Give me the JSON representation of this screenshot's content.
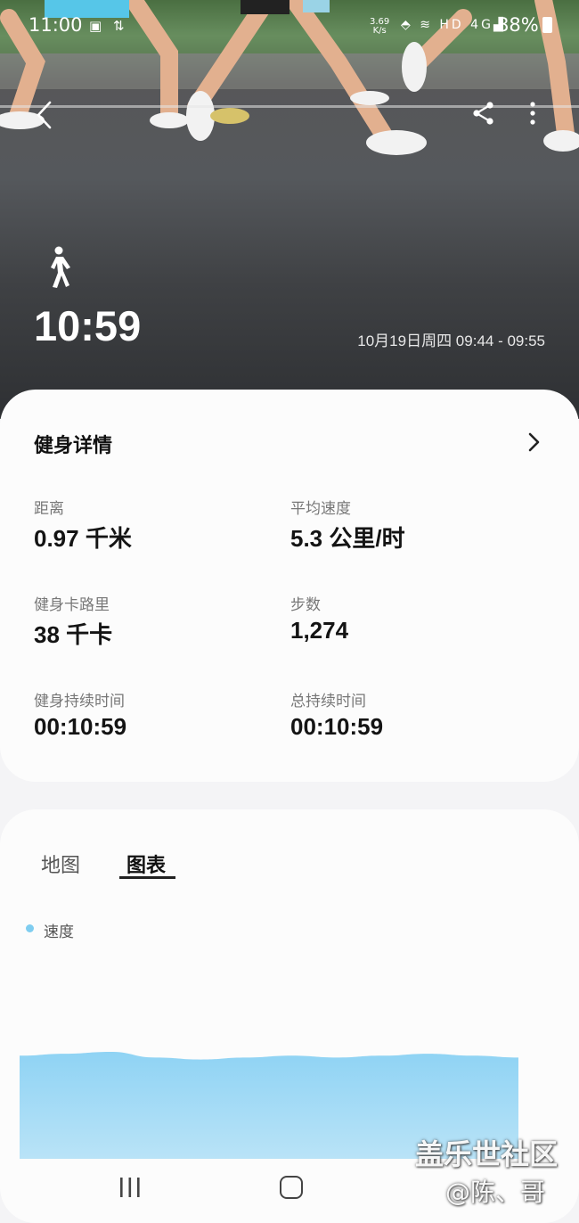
{
  "status_bar": {
    "time": "11:00",
    "net_speed_value": "3.69",
    "net_speed_unit": "K/s",
    "hd_label": "HD",
    "signal_label": "4G",
    "battery": "88%"
  },
  "workout": {
    "duration": "10:59",
    "date_range": "10月19日周四 09:44 - 09:55"
  },
  "details": {
    "title": "健身详情",
    "metrics": [
      {
        "label": "距离",
        "value": "0.97 千米"
      },
      {
        "label": "平均速度",
        "value": "5.3 公里/时"
      },
      {
        "label": "健身卡路里",
        "value": "38 千卡"
      },
      {
        "label": "步数",
        "value": "1,274"
      },
      {
        "label": "健身持续时间",
        "value": "00:10:59"
      },
      {
        "label": "总持续时间",
        "value": "00:10:59"
      }
    ]
  },
  "tabs": {
    "map": "地图",
    "chart": "图表",
    "selected": "图表"
  },
  "chart_data": {
    "type": "area",
    "series": [
      {
        "name": "速度",
        "color": "#8fd3f4",
        "values": [
          5.4,
          5.5,
          5.6,
          5.3,
          5.2,
          5.3,
          5.4,
          5.3,
          5.4,
          5.5,
          5.4,
          5.3
        ]
      }
    ],
    "title": "",
    "xlabel": "",
    "ylabel": "",
    "ylim": [
      0,
      7
    ]
  },
  "watermark": {
    "main": "盖乐世社区",
    "sub": "@陈、哥"
  },
  "colors": {
    "chart_fill": "#8fd3f4",
    "card_bg": "#fcfcfc",
    "page_bg": "#f4f4f6"
  }
}
